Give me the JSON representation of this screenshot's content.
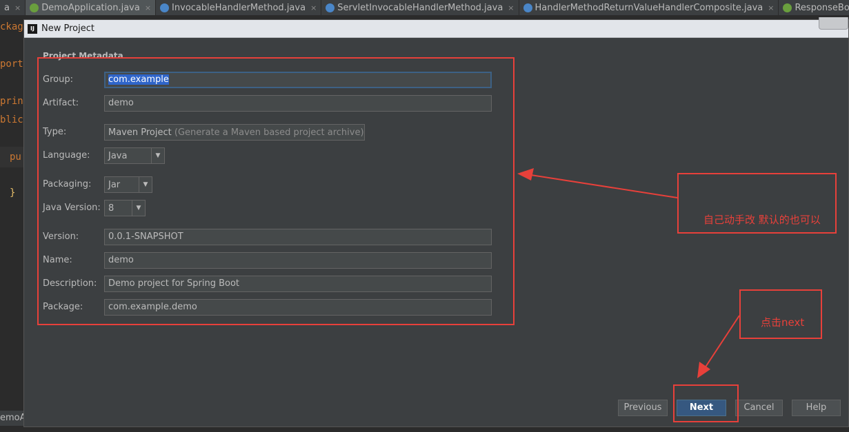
{
  "ide": {
    "tabs": [
      {
        "label": "a",
        "icon": "java-class-icon",
        "active": false
      },
      {
        "label": "DemoApplication.java",
        "icon": "spring-boot-class-icon",
        "active": true
      },
      {
        "label": "InvocableHandlerMethod.java",
        "icon": "java-class-icon",
        "active": false
      },
      {
        "label": "ServletInvocableHandlerMethod.java",
        "icon": "java-class-icon",
        "active": false
      },
      {
        "label": "HandlerMethodReturnValueHandlerComposite.java",
        "icon": "java-class-icon",
        "active": false
      },
      {
        "label": "ResponseBody.java",
        "icon": "annotation-icon",
        "active": false
      }
    ],
    "tab_close_glyph": "×",
    "code_fragments": [
      "ckag",
      "port",
      "prin",
      "blic",
      "pu",
      "}"
    ],
    "bottom_tab_label": "emoAp"
  },
  "dialog": {
    "app_icon_text": "IJ",
    "title": "New Project",
    "section_title": "Project Metadata",
    "fields": {
      "group": {
        "label": "Group:",
        "value": "com.example"
      },
      "artifact": {
        "label": "Artifact:",
        "value": "demo"
      },
      "type": {
        "label": "Type:",
        "value": "Maven Project",
        "hint": "(Generate a Maven based project archive)"
      },
      "language": {
        "label": "Language:",
        "value": "Java"
      },
      "packaging": {
        "label": "Packaging:",
        "value": "Jar"
      },
      "java_version": {
        "label": "Java Version:",
        "value": "8"
      },
      "version": {
        "label": "Version:",
        "value": "0.0.1-SNAPSHOT"
      },
      "name": {
        "label": "Name:",
        "value": "demo"
      },
      "description": {
        "label": "Description:",
        "value": "Demo project for Spring Boot"
      },
      "package": {
        "label": "Package:",
        "value": "com.example.demo"
      }
    },
    "buttons": {
      "previous": "Previous",
      "next": "Next",
      "cancel": "Cancel",
      "help": "Help"
    }
  },
  "annotations": {
    "note_edit": "自己动手改 默认的也可以",
    "note_next": "点击next",
    "color": "#e8403a"
  },
  "colors": {
    "dialog_bg": "#3c3f41",
    "field_bg": "#45494a",
    "primary_button": "#365880",
    "selection": "#2f65ca"
  }
}
